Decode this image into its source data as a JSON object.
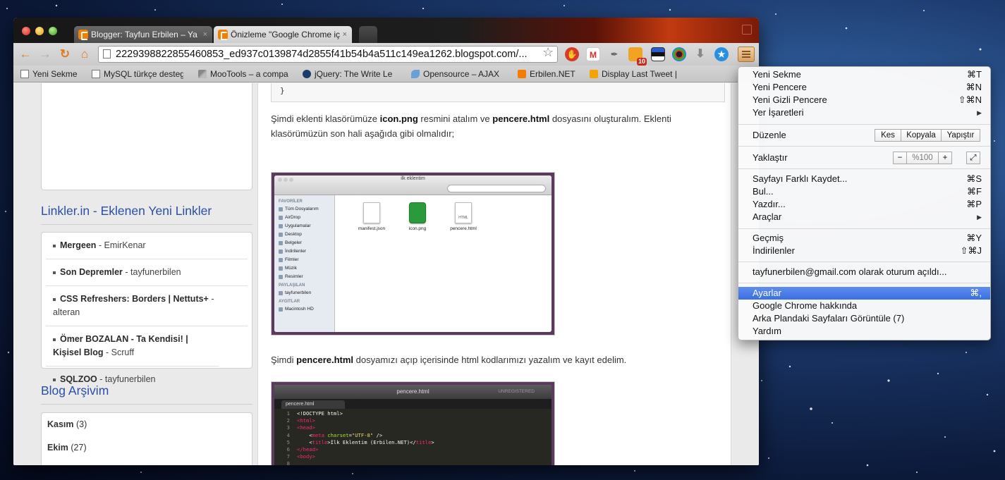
{
  "tabs": [
    {
      "title": "Blogger: Tayfun Erbilen – Ya",
      "close": "×"
    },
    {
      "title": "Önizleme \"Google Chrome iç",
      "close": "×"
    }
  ],
  "toolbar": {
    "back": "←",
    "forward": "→",
    "reload": "↻",
    "home": "⌂",
    "url": "2229398822855460853_ed937c0139874d2855f41b54b4a511c149ea1262.blogspot.com/...",
    "star": "☆",
    "badge": "10"
  },
  "bookmarks": [
    {
      "label": "Yeni Sekme",
      "icon": "page-icon"
    },
    {
      "label": "MySQL türkçe desteg",
      "icon": "page-icon"
    },
    {
      "label": "MooTools – a compa",
      "icon": "wrench-icon"
    },
    {
      "label": "jQuery: The Write Le",
      "icon": "jquery-icon"
    },
    {
      "label": "Opensource – AJAX",
      "icon": "opensource-icon"
    },
    {
      "label": "Erbilen.NET",
      "icon": "blogger-icon"
    },
    {
      "label": "Display Last Tweet |",
      "icon": "tweet-icon"
    }
  ],
  "sidebar": {
    "links_title": "Linkler.in - Eklenen Yeni Linkler",
    "links": [
      {
        "title": "Mergeen",
        "author": "- EmirKenar"
      },
      {
        "title": "Son Depremler",
        "author": "- tayfunerbilen"
      },
      {
        "title": "CSS Refreshers: Borders | Nettuts+",
        "author": "- alteran"
      },
      {
        "title": "Ömer BOZALAN - Ta Kendisi! | Kişisel Blog",
        "author": "- Scruff"
      },
      {
        "title": "SQLZOO",
        "author": "- tayfunerbilen"
      }
    ],
    "archive_title": "Blog Arşivim",
    "archive": [
      {
        "month": "Kasım",
        "count": "(3)"
      },
      {
        "month": "Ekim",
        "count": "(27)"
      }
    ]
  },
  "content": {
    "code_tail": "}",
    "para1_a": "Şimdi eklenti klasörümüze ",
    "para1_b": "icon.png",
    "para1_c": " resmini atalım ve ",
    "para1_d": "pencere.html",
    "para1_e": " dosyasını oluşturalım. Eklenti klasörümüzün son hali aşağıda gibi olmalıdır;",
    "para2_a": "Şimdi ",
    "para2_b": "pencere.html",
    "para2_c": " dosyamızı açıp içerisinde html kodlarımızı yazalım ve kayıt edelim.",
    "finder": {
      "title": "ilk eklentim",
      "fav_header": "FAVORİLER",
      "fav_items": [
        "Tüm Dosyalarım",
        "AirDrop",
        "Uygulamalar",
        "Desktop",
        "Belgeler",
        "İndirilenler",
        "Filmler",
        "Müzik",
        "Resimler"
      ],
      "share_header": "PAYLAŞILAN",
      "share_items": [
        "tayfunerbilen"
      ],
      "device_header": "AYGITLAR",
      "device_items": [
        "Macintosh HD"
      ],
      "files": [
        "manifest.json",
        "icon.png",
        "pencere.html"
      ]
    },
    "editor": {
      "title": "pencere.html",
      "unregistered": "UNREGISTERED",
      "tab": "pencere.html"
    }
  },
  "menu": {
    "items": [
      {
        "label": "Yeni Sekme",
        "shortcut": "⌘T"
      },
      {
        "label": "Yeni Pencere",
        "shortcut": "⌘N"
      },
      {
        "label": "Yeni Gizli Pencere",
        "shortcut": "⇧⌘N"
      },
      {
        "label": "Yer İşaretleri",
        "shortcut": "▶"
      }
    ],
    "edit_label": "Düzenle",
    "edit_buttons": [
      "Kes",
      "Kopyala",
      "Yapıştır"
    ],
    "zoom_label": "Yaklaştır",
    "zoom_minus": "−",
    "zoom_value": "%100",
    "zoom_plus": "+",
    "items2": [
      {
        "label": "Sayfayı Farklı Kaydet...",
        "shortcut": "⌘S"
      },
      {
        "label": "Bul...",
        "shortcut": "⌘F"
      },
      {
        "label": "Yazdır...",
        "shortcut": "⌘P"
      },
      {
        "label": "Araçlar",
        "shortcut": "▶"
      }
    ],
    "items3": [
      {
        "label": "Geçmiş",
        "shortcut": "⌘Y"
      },
      {
        "label": "İndirilenler",
        "shortcut": "⇧⌘J"
      }
    ],
    "signed_in": "tayfunerbilen@gmail.com olarak oturum açıldı...",
    "items4": [
      {
        "label": "Ayarlar",
        "shortcut": "⌘,"
      },
      {
        "label": "Google Chrome hakkında",
        "shortcut": ""
      },
      {
        "label": "Arka Plandaki Sayfaları Görüntüle (7)",
        "shortcut": ""
      },
      {
        "label": "Yardım",
        "shortcut": ""
      }
    ]
  }
}
